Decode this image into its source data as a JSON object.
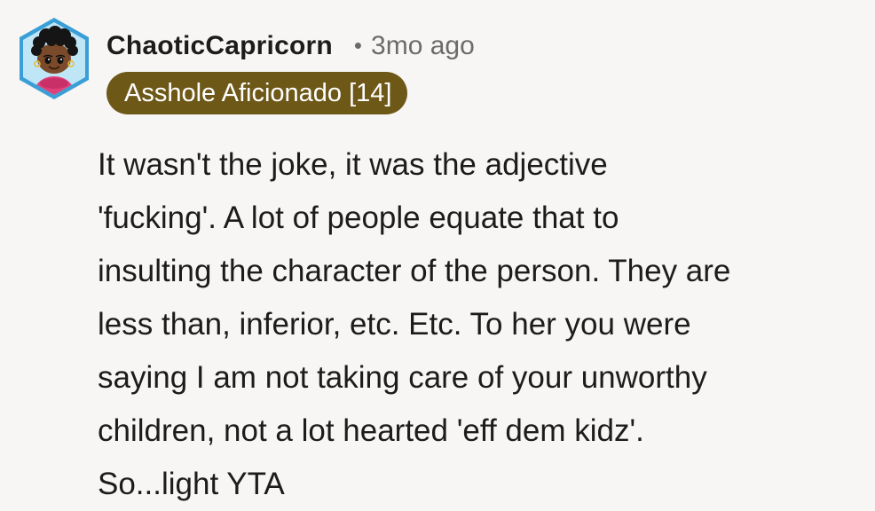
{
  "comment": {
    "username": "ChaoticCapricorn",
    "separator": "•",
    "timestamp": "3mo ago",
    "flair": "Asshole Aficionado [14]",
    "avatar_icon": "snoo-avatar-icon",
    "body_lines": [
      "It wasn't the joke, it was the adjective",
      "'fucking'. A lot of people equate that to",
      "insulting the character of the person. They are",
      "less than, inferior, etc. Etc. To her you were",
      "saying I am not taking care of your unworthy",
      "children, not a lot hearted 'eff dem kidz'.",
      "So...light YTA"
    ]
  },
  "colors": {
    "background": "#f8f6f4",
    "flair_background": "#6d5818",
    "flair_text": "#ffffff",
    "meta_text": "#6b6b6b",
    "avatar_frame": "#4aa8d8"
  }
}
